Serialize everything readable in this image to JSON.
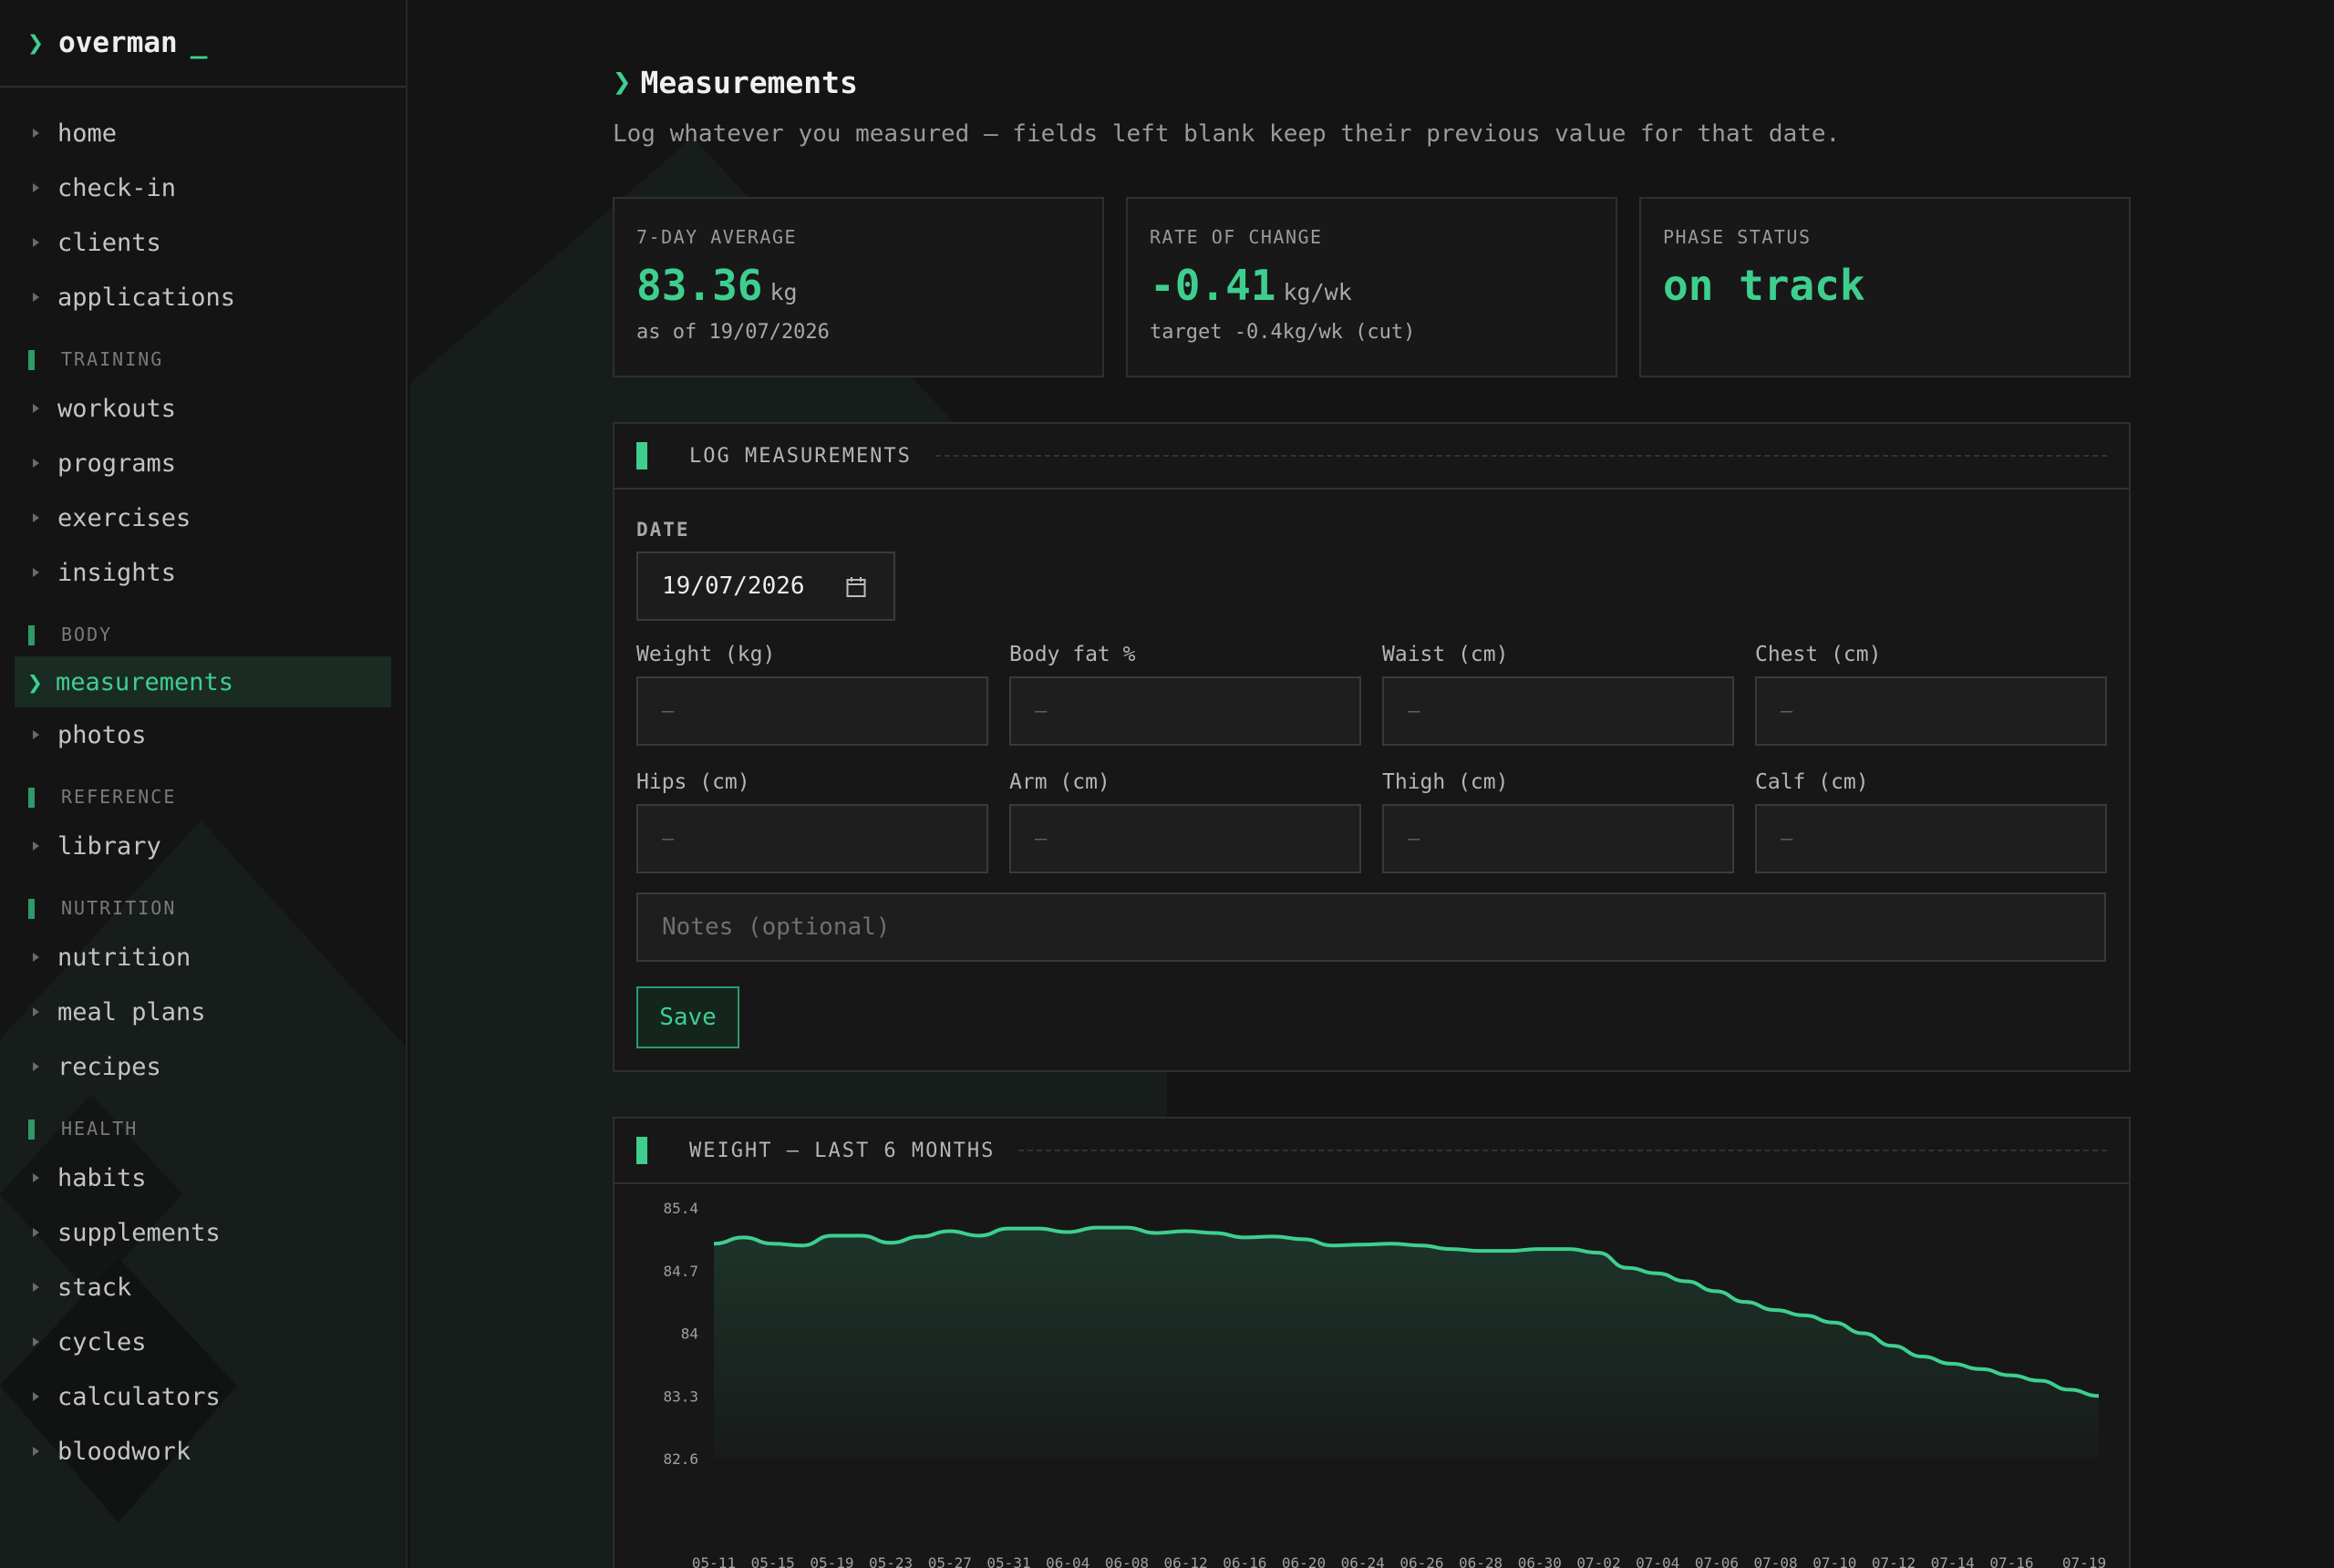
{
  "app": {
    "name": "overman",
    "cursor": "_"
  },
  "sidebar": {
    "top_items": [
      {
        "label": "home"
      },
      {
        "label": "check-in"
      },
      {
        "label": "clients"
      },
      {
        "label": "applications"
      }
    ],
    "sections": [
      {
        "title": "TRAINING",
        "items": [
          {
            "label": "workouts"
          },
          {
            "label": "programs"
          },
          {
            "label": "exercises"
          },
          {
            "label": "insights"
          }
        ]
      },
      {
        "title": "BODY",
        "items": [
          {
            "label": "measurements",
            "active": true
          },
          {
            "label": "photos"
          }
        ]
      },
      {
        "title": "REFERENCE",
        "items": [
          {
            "label": "library"
          }
        ]
      },
      {
        "title": "NUTRITION",
        "items": [
          {
            "label": "nutrition"
          },
          {
            "label": "meal plans"
          },
          {
            "label": "recipes"
          }
        ]
      },
      {
        "title": "HEALTH",
        "items": [
          {
            "label": "habits"
          },
          {
            "label": "supplements"
          },
          {
            "label": "stack"
          },
          {
            "label": "cycles"
          },
          {
            "label": "calculators"
          },
          {
            "label": "bloodwork"
          }
        ]
      }
    ]
  },
  "page": {
    "title": "Measurements",
    "subtitle": "Log whatever you measured — fields left blank keep their previous value for that date."
  },
  "stats": [
    {
      "label": "7-DAY AVERAGE",
      "value": "83.36",
      "unit": "kg",
      "sub": "as of 19/07/2026"
    },
    {
      "label": "RATE OF CHANGE",
      "value": "-0.41",
      "unit": "kg/wk",
      "sub": "target -0.4kg/wk (cut)"
    },
    {
      "label": "PHASE STATUS",
      "value": "on track",
      "unit": "",
      "sub": ""
    }
  ],
  "log_panel": {
    "title": "LOG MEASUREMENTS",
    "date_label": "DATE",
    "date_value": "19/07/2026",
    "fields": [
      {
        "label": "Weight (kg)",
        "placeholder": "–"
      },
      {
        "label": "Body fat %",
        "placeholder": "–"
      },
      {
        "label": "Waist (cm)",
        "placeholder": "–"
      },
      {
        "label": "Chest (cm)",
        "placeholder": "–"
      },
      {
        "label": "Hips (cm)",
        "placeholder": "–"
      },
      {
        "label": "Arm (cm)",
        "placeholder": "–"
      },
      {
        "label": "Thigh (cm)",
        "placeholder": "–"
      },
      {
        "label": "Calf (cm)",
        "placeholder": "–"
      }
    ],
    "notes_placeholder": "Notes (optional)",
    "save_label": "Save"
  },
  "chart_panel": {
    "title": "WEIGHT — LAST 6 MONTHS"
  },
  "colors": {
    "accent": "#3ecf8e",
    "background": "#141414",
    "panel": "#171717",
    "border": "#2f2f2f"
  },
  "chart_data": {
    "type": "area",
    "title": "WEIGHT — LAST 6 MONTHS",
    "ylim": [
      82.6,
      85.4
    ],
    "yticks": [
      "85.4",
      "84.7",
      "84",
      "83.3",
      "82.6"
    ],
    "xticks": [
      "05-11",
      "05-15",
      "05-19",
      "05-23",
      "05-27",
      "05-31",
      "06-04",
      "06-08",
      "06-12",
      "06-16",
      "06-20",
      "06-24",
      "06-26",
      "06-28",
      "06-30",
      "07-02",
      "07-04",
      "07-06",
      "07-08",
      "07-10",
      "07-12",
      "07-14",
      "07-16",
      "07-19"
    ],
    "x": [
      0,
      1,
      2,
      3,
      4,
      5,
      6,
      7,
      8,
      9,
      10,
      11,
      12,
      13,
      14,
      15,
      16,
      17,
      18,
      19,
      20,
      21,
      22,
      23,
      24,
      25,
      26,
      27,
      28,
      29,
      30,
      31,
      32,
      33,
      34,
      35,
      36,
      37,
      38,
      39,
      40,
      41,
      42,
      43,
      44,
      45,
      46,
      47
    ],
    "values": [
      85.0,
      85.07,
      85.0,
      84.98,
      85.09,
      85.09,
      85.01,
      85.08,
      85.14,
      85.09,
      85.17,
      85.17,
      85.13,
      85.18,
      85.18,
      85.12,
      85.14,
      85.12,
      85.07,
      85.08,
      85.05,
      84.98,
      84.99,
      85.0,
      84.98,
      84.94,
      84.92,
      84.92,
      84.94,
      84.94,
      84.9,
      84.73,
      84.67,
      84.58,
      84.47,
      84.35,
      84.26,
      84.2,
      84.12,
      84.0,
      83.86,
      83.74,
      83.66,
      83.6,
      83.53,
      83.47,
      83.37,
      83.3
    ]
  }
}
